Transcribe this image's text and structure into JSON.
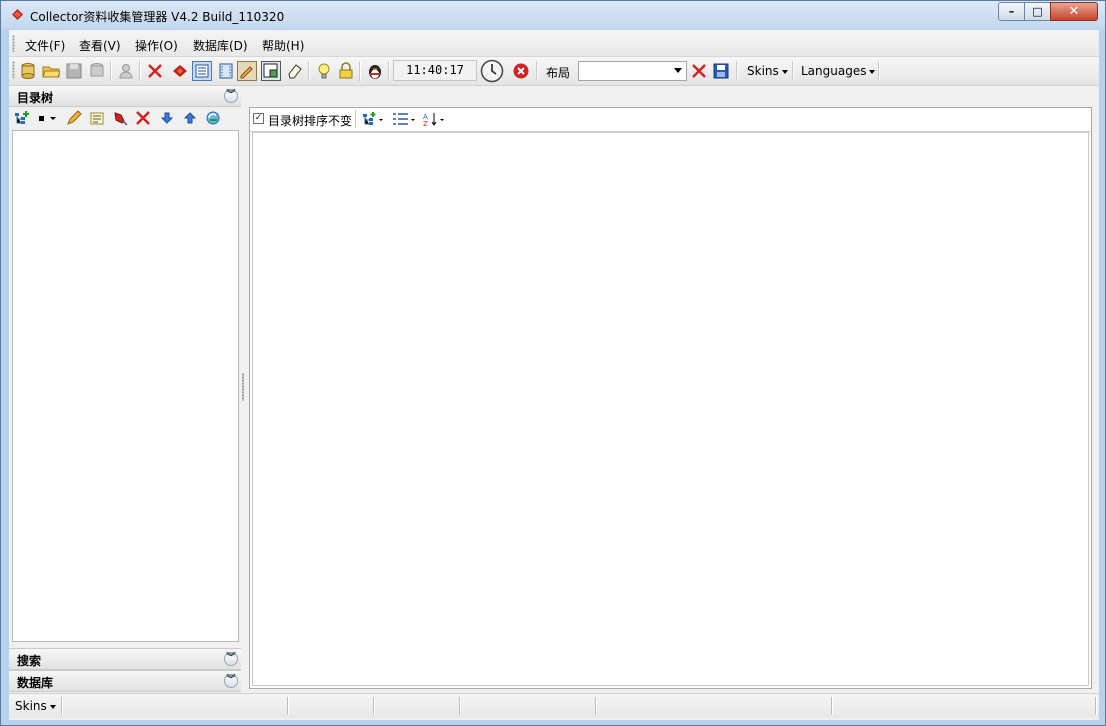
{
  "window": {
    "title": "Collector资料收集管理器 V4.2 Build_110320"
  },
  "menu": [
    "文件(F)",
    "查看(V)",
    "操作(O)",
    "数据库(D)",
    "帮助(H)"
  ],
  "toolbar": {
    "clock": "11:40:17",
    "layout_label": "布局",
    "layout_value": "",
    "skins_label": "Skins",
    "languages_label": "Languages"
  },
  "left_panel": {
    "tree_title": "目录树",
    "search_title": "搜索",
    "database_title": "数据库"
  },
  "right_panel": {
    "sort_checkbox_label": "目录树排序不变",
    "sort_checked": true,
    "sort_check_mark": "✓"
  },
  "statusbar": {
    "skins_label": "Skins"
  },
  "colors": {
    "accent_red": "#d42020",
    "title_bar": "#c3d8ee",
    "chrome": "#f0f0f0"
  }
}
